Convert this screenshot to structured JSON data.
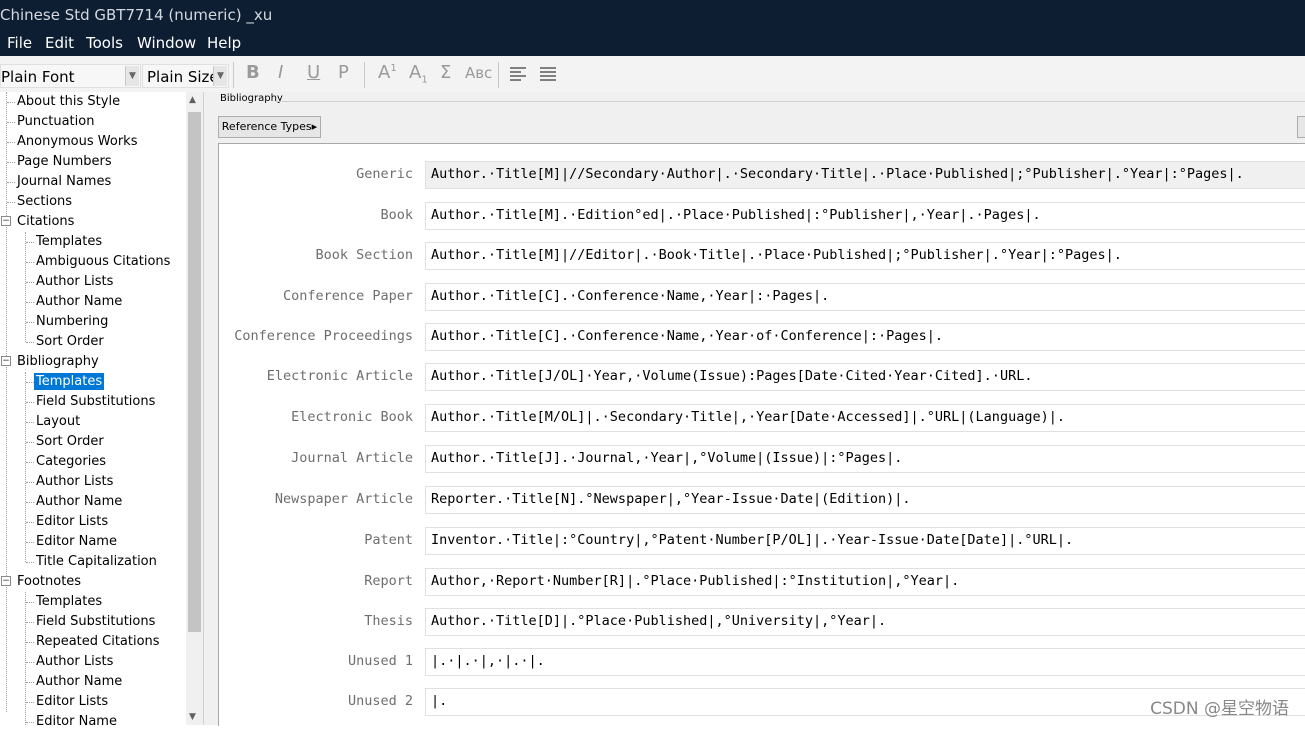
{
  "window": {
    "title": "Chinese Std GBT7714 (numeric) _xu"
  },
  "menu": [
    "File",
    "Edit",
    "Tools",
    "Window",
    "Help"
  ],
  "toolbar": {
    "font": "Plain Font",
    "size": "Plain Size",
    "bold": "B",
    "italic": "I",
    "underline": "U",
    "plain": "P",
    "superscript": "A",
    "superscript_mark": "1",
    "subscript": "A",
    "subscript_mark": "1",
    "symbol": "Σ",
    "smallcaps": "Aʙᴄ"
  },
  "sidebar": {
    "items": [
      "About this Style",
      "Punctuation",
      "Anonymous Works",
      "Page Numbers",
      "Journal Names",
      "Sections",
      "Citations",
      "Templates",
      "Ambiguous Citations",
      "Author Lists",
      "Author Name",
      "Numbering",
      "Sort Order",
      "Bibliography",
      "Templates",
      "Field Substitutions",
      "Layout",
      "Sort Order",
      "Categories",
      "Author Lists",
      "Author Name",
      "Editor Lists",
      "Editor Name",
      "Title Capitalization",
      "Footnotes",
      "Templates",
      "Field Substitutions",
      "Repeated Citations",
      "Author Lists",
      "Author Name",
      "Editor Lists",
      "Editor Name"
    ],
    "selected": "Templates"
  },
  "panel": {
    "group_label": "Bibliography",
    "reference_types_button": "Reference Types▸"
  },
  "templates": [
    {
      "label": "Generic",
      "value": "Author.·Title[M]|//Secondary·Author|.·Secondary·Title|.·Place·Published|;°Publisher|.°Year|:°Pages|."
    },
    {
      "label": "Book",
      "value": "Author.·Title[M].·Edition°ed|.·Place·Published|:°Publisher|,·Year|.·Pages|."
    },
    {
      "label": "Book Section",
      "value": "Author.·Title[M]|//Editor|.·Book·Title|.·Place·Published|;°Publisher|.°Year|:°Pages|."
    },
    {
      "label": "Conference Paper",
      "value": "Author.·Title[C].·Conference·Name,·Year|:·Pages|."
    },
    {
      "label": "Conference Proceedings",
      "value": "Author.·Title[C].·Conference·Name,·Year·of·Conference|:·Pages|."
    },
    {
      "label": "Electronic Article",
      "value": "Author.·Title[J/OL]·Year,·Volume(Issue):Pages[Date·Cited·Year·Cited].·URL."
    },
    {
      "label": "Electronic Book",
      "value": "Author.·Title[M/OL]|.·Secondary·Title|,·Year[Date·Accessed]|.°URL|(Language)|."
    },
    {
      "label": "Journal Article",
      "value": "Author.·Title[J].·Journal,·Year|,°Volume|(Issue)|:°Pages|."
    },
    {
      "label": "Newspaper Article",
      "value": "Reporter.·Title[N].°Newspaper|,°Year-Issue·Date|(Edition)|."
    },
    {
      "label": "Patent",
      "value": "Inventor.·Title|:°Country|,°Patent·Number[P/OL]|.·Year-Issue·Date[Date]|.°URL|."
    },
    {
      "label": "Report",
      "value": "Author,·Report·Number[R]|.°Place·Published|:°Institution|,°Year|."
    },
    {
      "label": "Thesis",
      "value": "Author.·Title[D]|.°Place·Published|,°University|,°Year|."
    },
    {
      "label": "Unused 1",
      "value": "|.·|.·|,·|.·|."
    },
    {
      "label": "Unused 2",
      "value": "|."
    }
  ],
  "watermark": "CSDN @星空物语"
}
